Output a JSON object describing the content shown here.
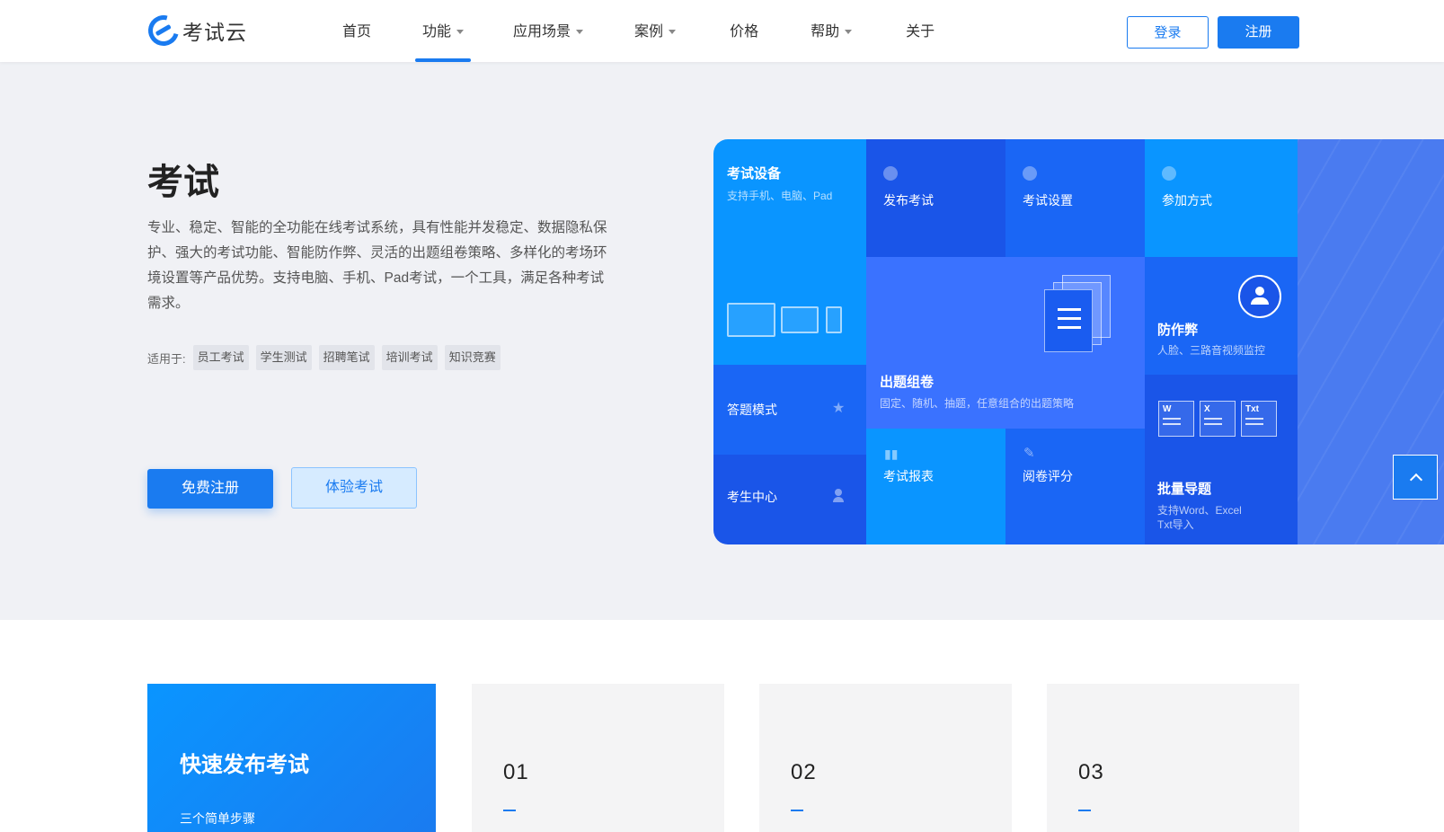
{
  "header": {
    "logo_text": "考试云",
    "nav": [
      {
        "label": "首页",
        "caret": false,
        "active": false
      },
      {
        "label": "功能",
        "caret": true,
        "active": true
      },
      {
        "label": "应用场景",
        "caret": true,
        "active": false
      },
      {
        "label": "案例",
        "caret": true,
        "active": false
      },
      {
        "label": "价格",
        "caret": false,
        "active": false
      },
      {
        "label": "帮助",
        "caret": true,
        "active": false
      },
      {
        "label": "关于",
        "caret": false,
        "active": false
      }
    ],
    "login": "登录",
    "register": "注册"
  },
  "hero": {
    "title": "考试",
    "description": "专业、稳定、智能的全功能在线考试系统，具有性能并发稳定、数据隐私保护、强大的考试功能、智能防作弊、灵活的出题组卷策略、多样化的考场环境设置等产品优势。支持电脑、手机、Pad考试，一个工具，满足各种考试需求。",
    "suit_label": "适用于:",
    "tags": [
      "员工考试",
      "学生测试",
      "招聘笔试",
      "培训考试",
      "知识竞赛"
    ],
    "btn_free": "免费注册",
    "btn_try": "体验考试"
  },
  "mosaic": {
    "device_title": "考试设备",
    "device_sub": "支持手机、电脑、Pad",
    "publish": "发布考试",
    "setting": "考试设置",
    "join": "参加方式",
    "compose_title": "出题组卷",
    "compose_sub": "固定、随机、抽题，任意组合的出题策略",
    "anti_title": "防作弊",
    "anti_sub": "人脸、三路音视频监控",
    "answer": "答题模式",
    "center": "考生中心",
    "report": "考试报表",
    "review": "阅卷评分",
    "import_title": "批量导题",
    "import_sub": "支持Word、Excel Txt导入",
    "doc_labels": [
      "W",
      "X",
      "Txt"
    ]
  },
  "lower": {
    "main_title": "快速发布考试",
    "main_sub": "三个简单步骤",
    "steps": [
      "01",
      "02",
      "03"
    ]
  }
}
